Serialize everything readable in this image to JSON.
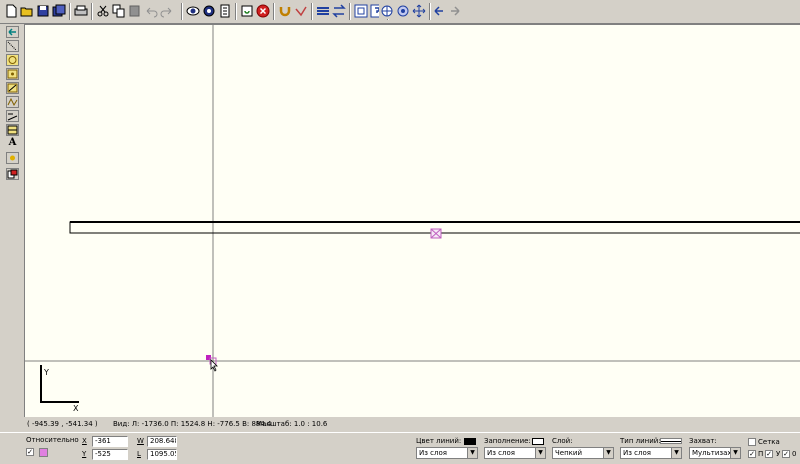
{
  "toolbar_icons": [
    "new-file-icon",
    "open-file-icon",
    "save-file-icon",
    "save-all-icon",
    "print-icon",
    "cut-icon",
    "copy-icon",
    "paste-icon",
    "undo-icon",
    "redo-icon",
    "view-icon",
    "view-2-icon",
    "page-icon",
    "stop-icon",
    "refresh-icon",
    "magnet-icon",
    "check-mark-icon",
    "layers-icon",
    "arrows-icon",
    "zoom-fit-icon",
    "zoom-window-icon",
    "zoom-in-icon",
    "zoom-pan-icon",
    "move-icon",
    "back-icon",
    "forward-icon"
  ],
  "left_tools": [
    "back-arrow-icon",
    "select-icon",
    "circle-tool-icon",
    "point-tool-icon",
    "line-tool-icon",
    "polyline-tool-icon",
    "measure-tool-icon",
    "rectangle-tool-icon",
    "text-tool-icon",
    "spot-tool-icon",
    "properties-tool-icon"
  ],
  "canvas": {
    "axis_y": "Y",
    "axis_x": "X"
  },
  "status": {
    "coords": "( -945.39 , -541.34 )",
    "view": "Вид: Л: -1736.0  П: 1524.8  Н: -776.5  В: 884.4",
    "scale": "Масштаб: 1.0 : 10.6"
  },
  "props": {
    "relative_label": "Относительно",
    "x_label": "X",
    "x_value": "-361",
    "y_label": "Y",
    "y_value": "-525",
    "w_label": "W",
    "w_value": "208.648",
    "l_label": "L",
    "l_value": "1095.05",
    "line_color_label": "Цвет линий:",
    "line_color_value": "Из слоя",
    "fill_label": "Заполнение:",
    "fill_value": "Из слоя",
    "layer_label": "Слой:",
    "layer_value": "Чепкий",
    "line_type_label": "Тип линий:",
    "line_type_value": "Из слоя",
    "snap_label": "Захват:",
    "snap_value": "Мультизахв",
    "grid_label": "Сетка",
    "p_label": "П",
    "u_label": "У",
    "zero_label": "0",
    "line_color_swatch": "#000000",
    "fill_swatch": "#ffffff"
  }
}
